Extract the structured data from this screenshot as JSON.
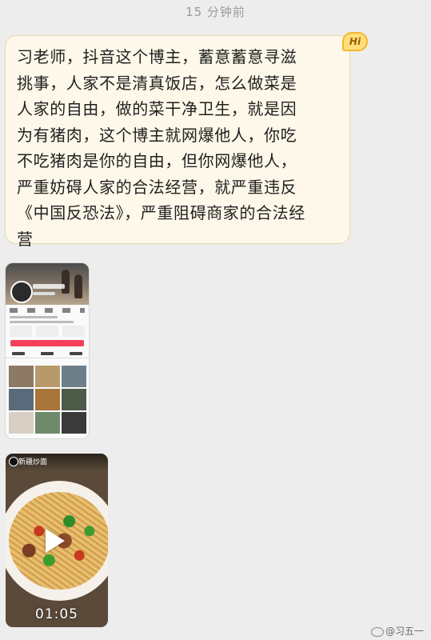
{
  "chat": {
    "timestamp": "15 分钟前",
    "message": {
      "text": "习老师，抖音这个博主，蓄意蓄意寻滋\n挑事，人家不是清真饭店，怎么做菜是\n人家的自由，做的菜干净卫生，就是因\n为有猪肉，这个博主就网爆他人，你吃\n不吃猪肉是你的自由，但你网爆他人，\n严重妨碍人家的合法经营，就严重违反\n《中国反恐法》，严重阻碍商家的合法经\n营",
      "badge": "Hi"
    },
    "video": {
      "overlay_title": "新疆炒面",
      "duration": "01:05"
    }
  },
  "watermark": "@习五一",
  "colors": {
    "background": "#ededed",
    "bubble": "#fdf8e9",
    "badge": "#ffe07a"
  }
}
